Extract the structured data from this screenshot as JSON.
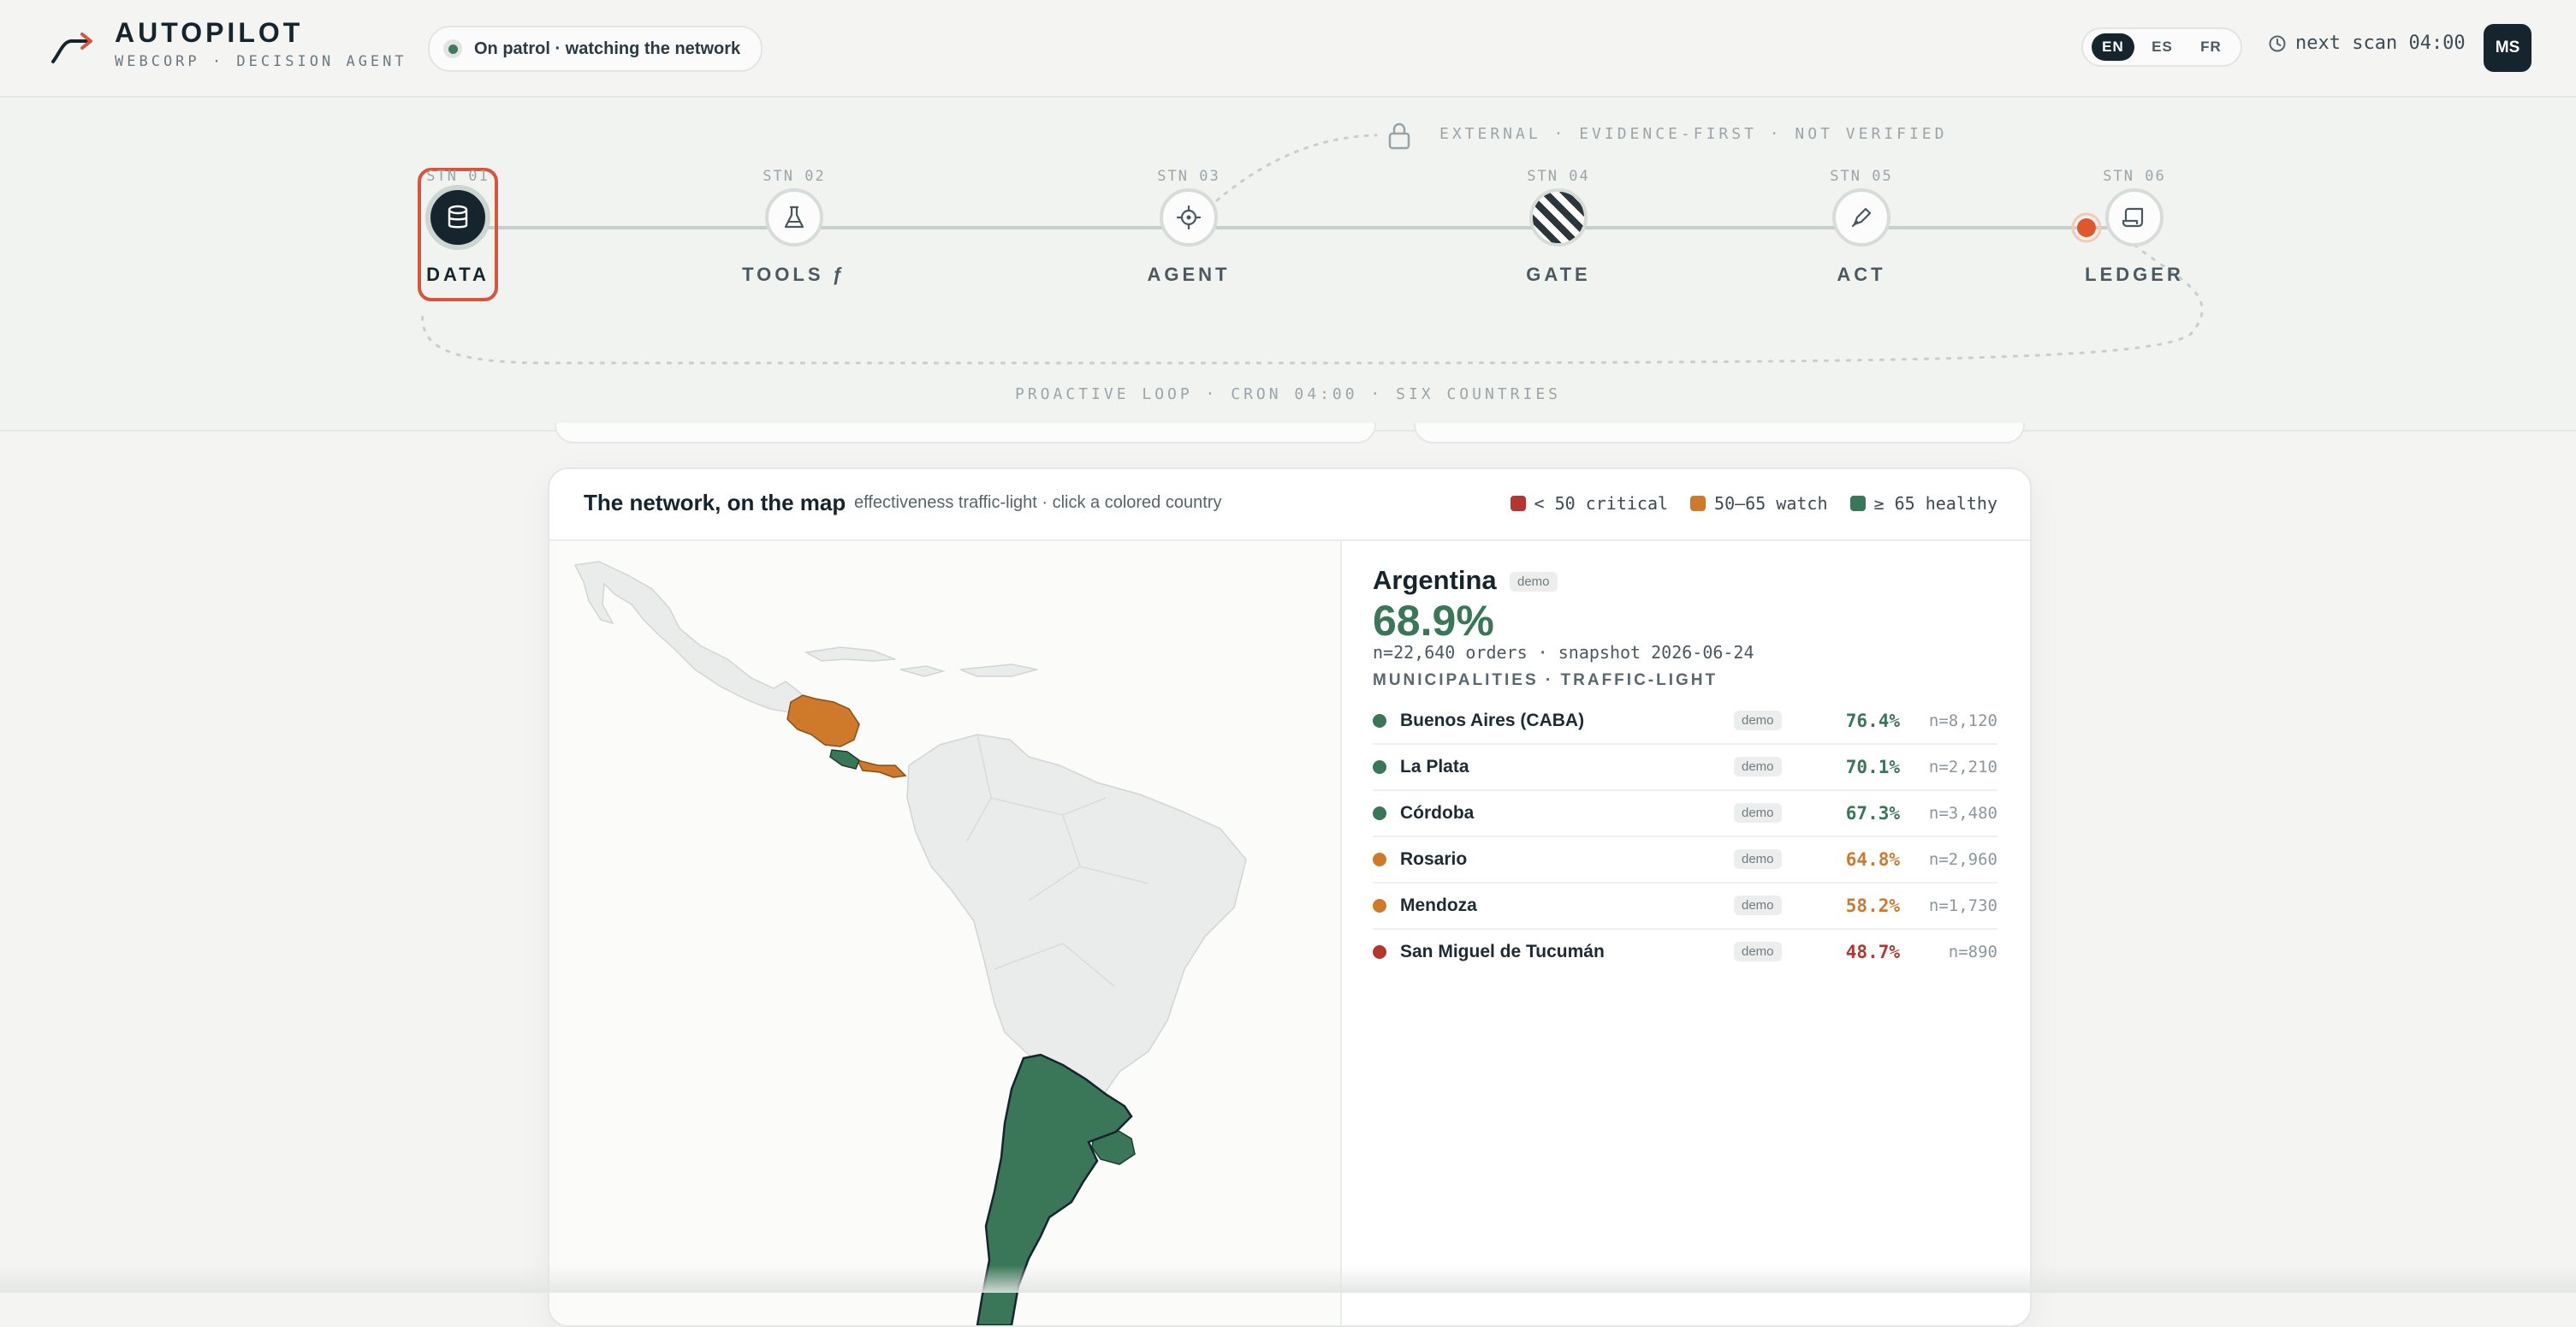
{
  "brand": {
    "title": "AUTOPILOT",
    "subtitle": "WEBCORP · DECISION AGENT"
  },
  "status": {
    "patrol_label": "On patrol · watching the network"
  },
  "languages": [
    {
      "code": "EN",
      "active": true
    },
    {
      "code": "ES",
      "active": false
    },
    {
      "code": "FR",
      "active": false
    }
  ],
  "scan": {
    "label": "next scan 04:00"
  },
  "user": {
    "initials": "MS"
  },
  "pipeline": {
    "external_note": "EXTERNAL · EVIDENCE-FIRST · NOT VERIFIED",
    "loop_note": "PROACTIVE LOOP · CRON 04:00 · SIX COUNTRIES",
    "stations": [
      {
        "code": "STN 01",
        "label": "DATA",
        "icon": "database-icon",
        "active": true
      },
      {
        "code": "STN 02",
        "label": "TOOLS ƒ",
        "icon": "flask-icon",
        "active": false
      },
      {
        "code": "STN 03",
        "label": "AGENT",
        "icon": "crosshair-icon",
        "active": false
      },
      {
        "code": "STN 04",
        "label": "GATE",
        "icon": "striped-gate-icon",
        "active": false
      },
      {
        "code": "STN 05",
        "label": "ACT",
        "icon": "pen-icon",
        "active": false
      },
      {
        "code": "STN 06",
        "label": "LEDGER",
        "icon": "scroll-icon",
        "active": false
      }
    ]
  },
  "map_card": {
    "title": "The network, on the map",
    "subtitle": "effectiveness traffic-light · click a colored country",
    "legend": [
      {
        "label": "< 50 critical",
        "color": "#b5362f"
      },
      {
        "label": "50–65 watch",
        "color": "#cf7a2b"
      },
      {
        "label": "≥ 65 healthy",
        "color": "#3a7658"
      }
    ],
    "colors": {
      "healthy": "#3a7658",
      "watch": "#cf7a2b",
      "critical": "#b5362f",
      "land": "#e9ecea"
    }
  },
  "detail": {
    "country": "Argentina",
    "country_tag": "demo",
    "effectiveness": "68.9%",
    "meta": "n=22,640 orders · snapshot 2026-06-24",
    "section_title": "MUNICIPALITIES · TRAFFIC-LIGHT",
    "municipalities": [
      {
        "name": "Buenos Aires (CABA)",
        "tag": "demo",
        "pct": "76.4%",
        "n": "n=8,120",
        "status": "green"
      },
      {
        "name": "La Plata",
        "tag": "demo",
        "pct": "70.1%",
        "n": "n=2,210",
        "status": "green"
      },
      {
        "name": "Córdoba",
        "tag": "demo",
        "pct": "67.3%",
        "n": "n=3,480",
        "status": "green"
      },
      {
        "name": "Rosario",
        "tag": "demo",
        "pct": "64.8%",
        "n": "n=2,960",
        "status": "orange"
      },
      {
        "name": "Mendoza",
        "tag": "demo",
        "pct": "58.2%",
        "n": "n=1,730",
        "status": "orange"
      },
      {
        "name": "San Miguel de Tucumán",
        "tag": "demo",
        "pct": "48.7%",
        "n": "n=890",
        "status": "red"
      }
    ]
  }
}
